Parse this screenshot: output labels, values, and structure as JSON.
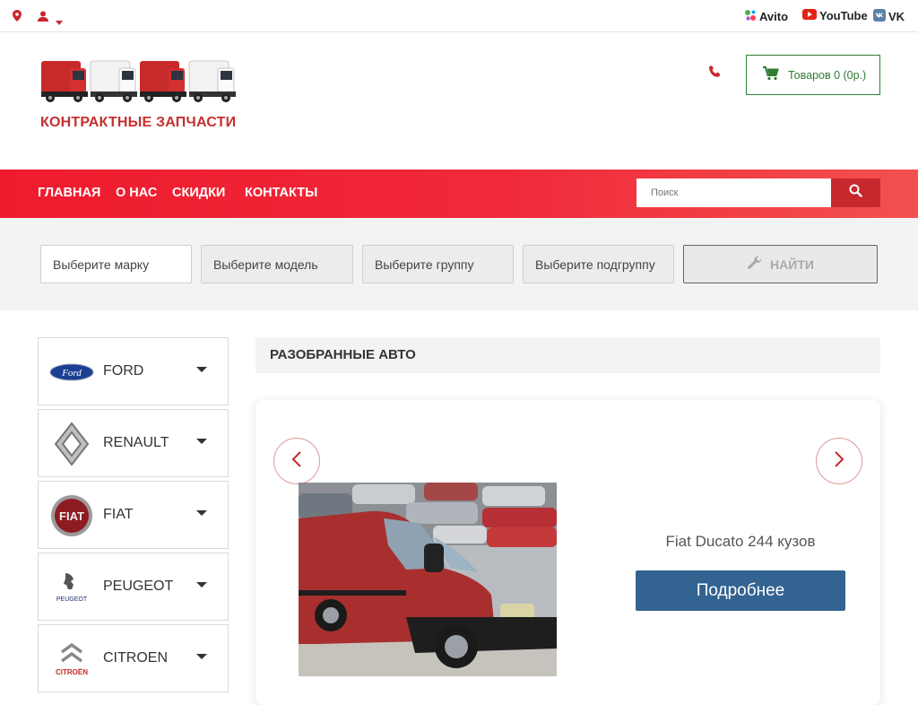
{
  "topbar": {
    "social": [
      {
        "label": "Avito",
        "icon": "avito-icon"
      },
      {
        "label": "YouTube",
        "icon": "youtube-icon"
      },
      {
        "label": "VK",
        "icon": "vk-icon"
      }
    ]
  },
  "header": {
    "brand": "КОНТРАКТНЫЕ ЗАПЧАСТИ",
    "cart_label": "Товаров 0 (0р.)"
  },
  "nav": {
    "items": [
      "ГЛАВНАЯ",
      "О НАС",
      "СКИДКИ",
      "КОНТАКТЫ"
    ],
    "search_placeholder": "Поиск"
  },
  "filters": {
    "make": "Выберите марку",
    "model": "Выберите модель",
    "group": "Выберите группу",
    "subgroup": "Выберите подгруппу",
    "find_label": "НАЙТИ"
  },
  "sidebar": {
    "brands": [
      "FORD",
      "RENAULT",
      "FIAT",
      "PEUGEOT",
      "CITROEN"
    ]
  },
  "main": {
    "section_title": "РАЗОБРАННЫЕ АВТО",
    "slide": {
      "title": "Fiat Ducato 244 кузов",
      "button": "Подробнее"
    }
  },
  "colors": {
    "accent_red": "#ee1b2e",
    "brand_red": "#c5302e",
    "cart_green": "#2e7d32",
    "button_blue": "#336391"
  }
}
